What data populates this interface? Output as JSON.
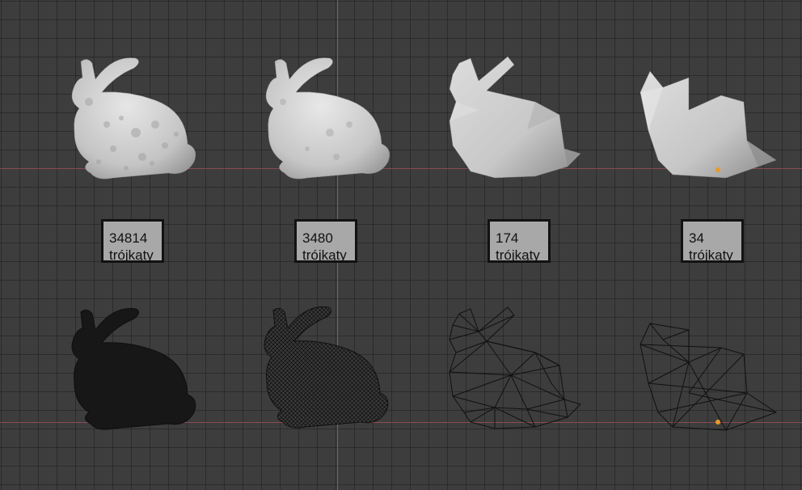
{
  "scene": {
    "colors": {
      "background": "#3d3d3d",
      "grid_line": "#2f2f2f",
      "x_axis": "#8a4a52",
      "y_axis": "#4b6ea0",
      "label_bg": "#a8a8a8",
      "label_border": "#121212",
      "solid_shade": "#c4c4c4",
      "wireframe_dense": "#141414",
      "wireframe_sparse": "#101010",
      "origin_point": "#e69a2a"
    },
    "models": [
      {
        "triangles": "34814",
        "unit": "trójkąty"
      },
      {
        "triangles": "3480",
        "unit": "trójkąty"
      },
      {
        "triangles": "174",
        "unit": "trójkąty"
      },
      {
        "triangles": "34",
        "unit": "trójkąty"
      }
    ]
  }
}
